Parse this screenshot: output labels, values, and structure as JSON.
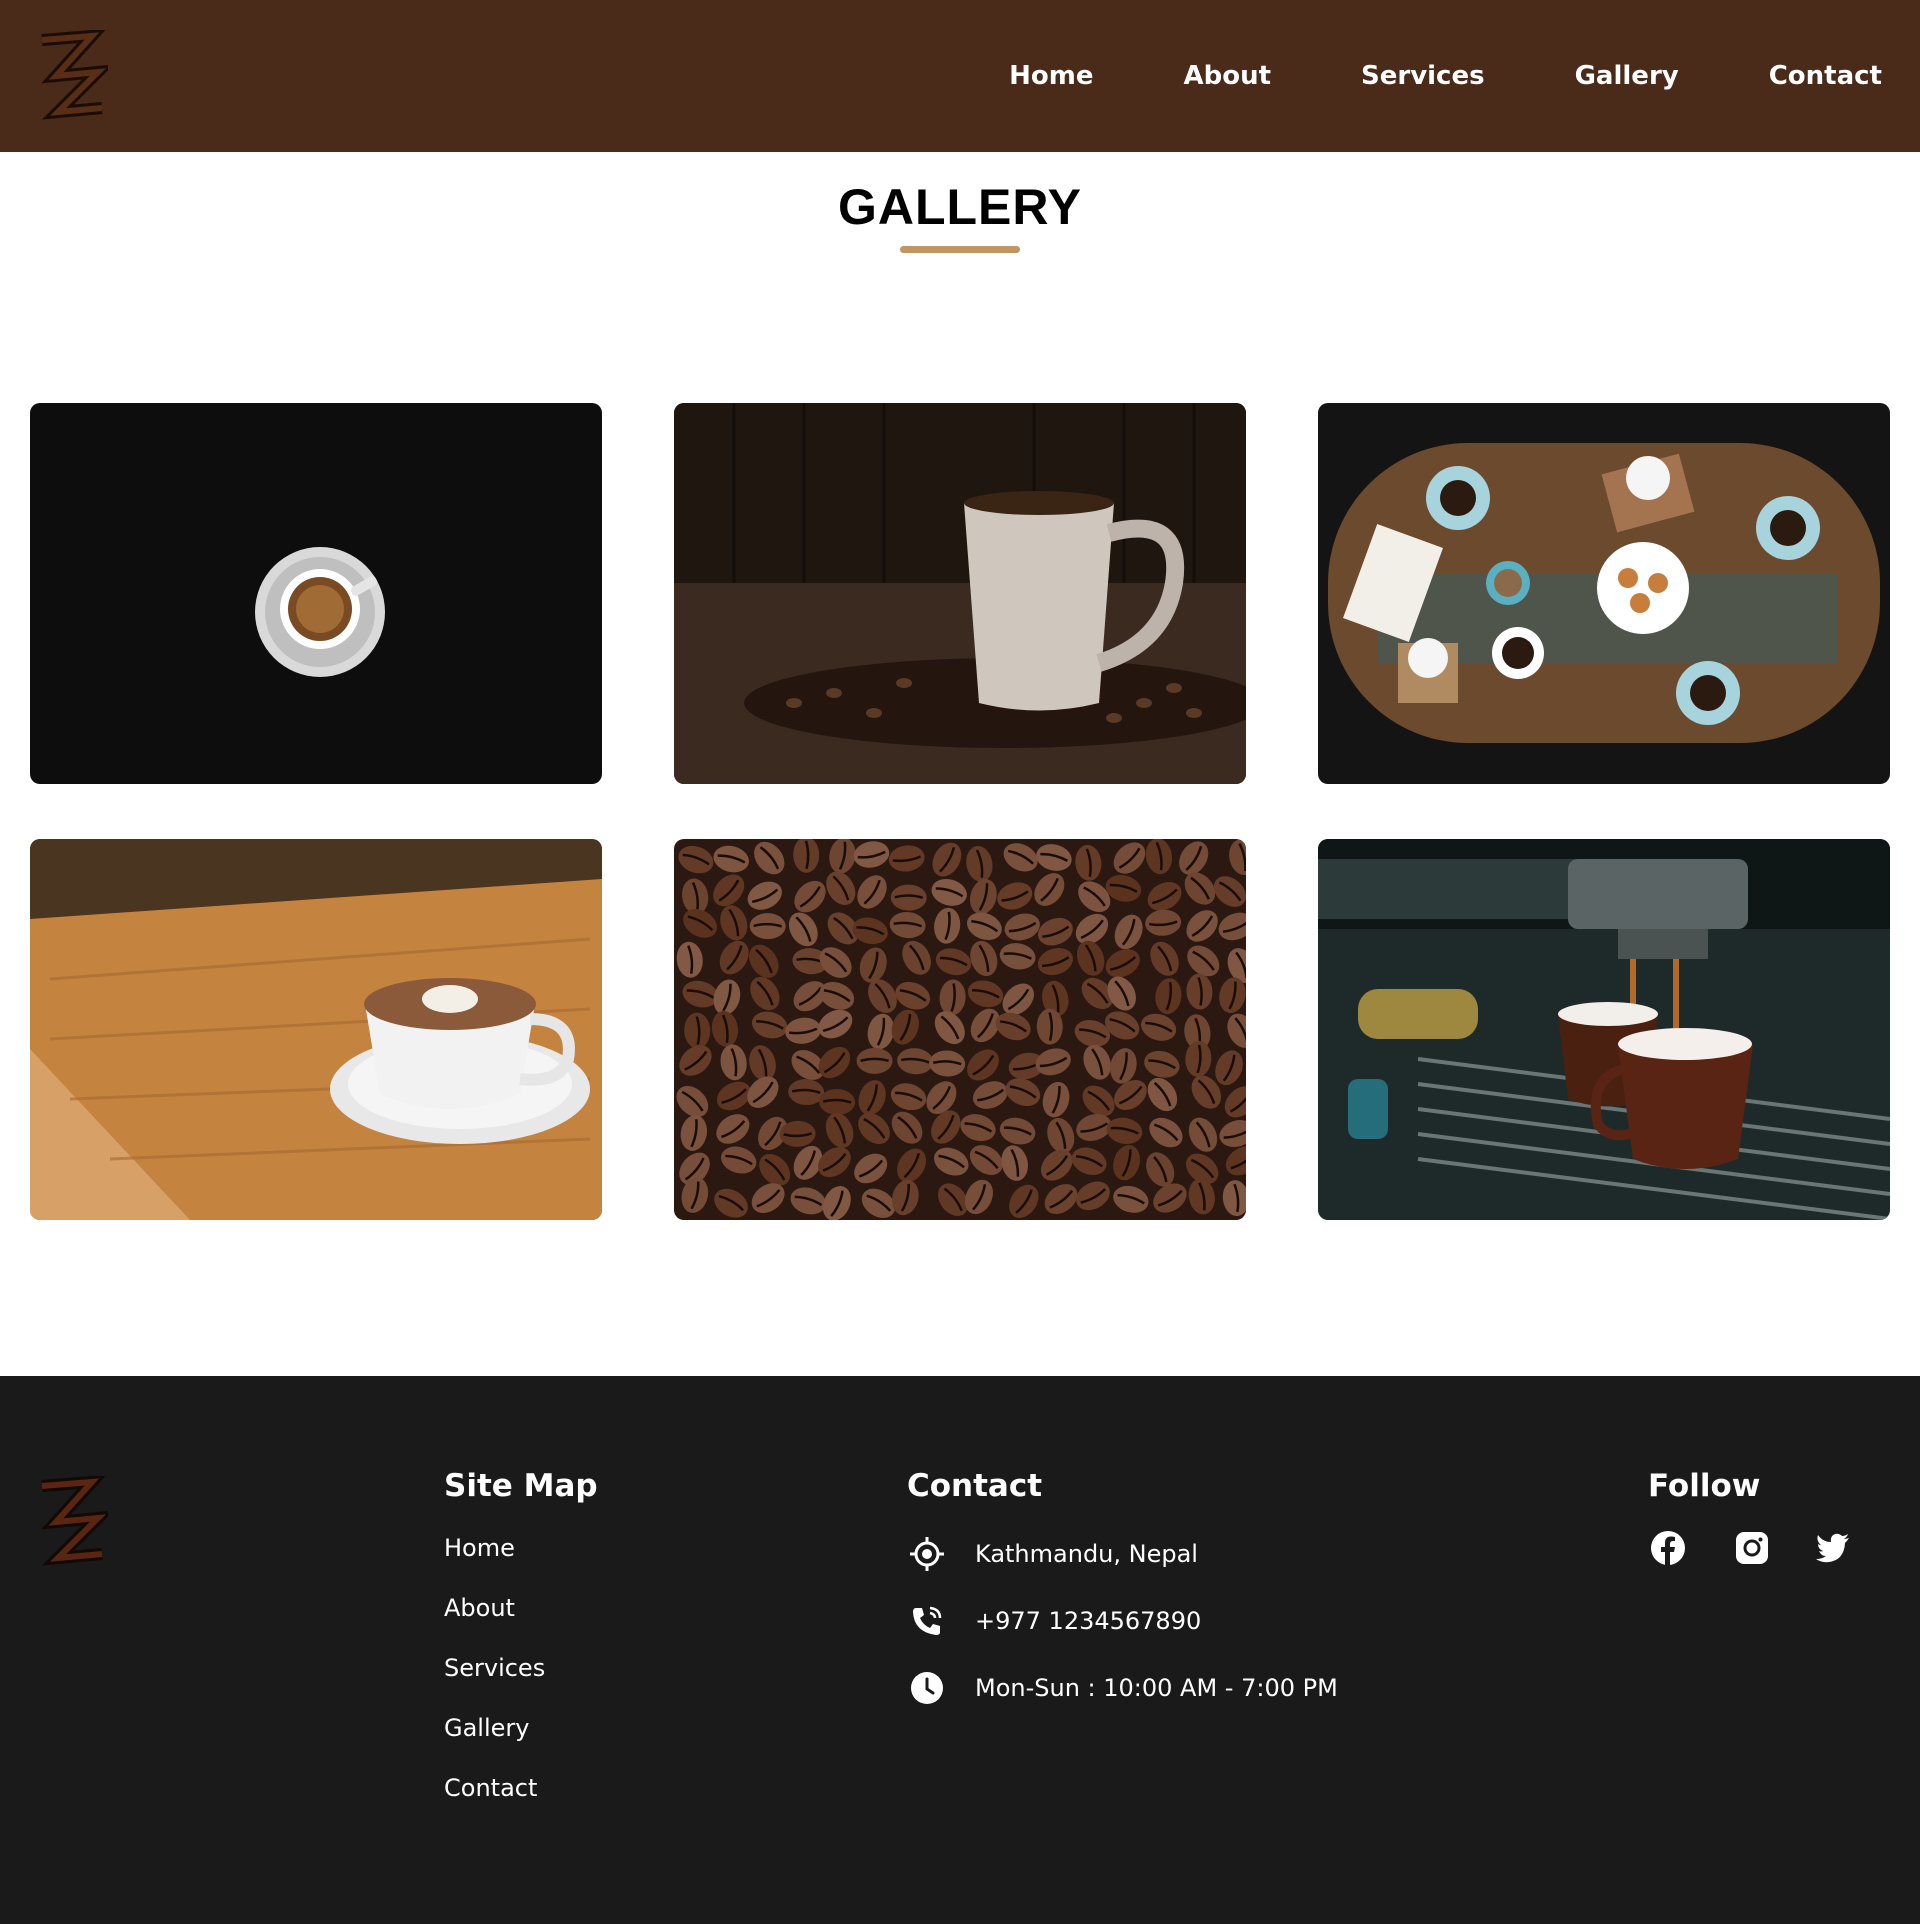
{
  "header": {
    "logo": "zz-logo",
    "nav": [
      "Home",
      "About",
      "Services",
      "Gallery",
      "Contact"
    ]
  },
  "page": {
    "title": "GALLERY",
    "accent_color": "#c1955f",
    "header_color": "#4a2a18",
    "footer_color": "#1a1a1a"
  },
  "gallery": {
    "images": [
      "espresso cup on dark table",
      "white mug with coffee beans",
      "cafe table with cups from above",
      "latte art cup on wooden table",
      "roasted coffee beans",
      "espresso machine pouring into cups"
    ]
  },
  "footer": {
    "sitemap_title": "Site Map",
    "sitemap_links": [
      "Home",
      "About",
      "Services",
      "Gallery",
      "Contact"
    ],
    "contact_title": "Contact",
    "contact": {
      "location": "Kathmandu, Nepal",
      "phone": "+977 1234567890",
      "hours": "Mon-Sun : 10:00 AM - 7:00 PM"
    },
    "follow_title": "Follow",
    "social_icons": [
      "facebook-icon",
      "instagram-icon",
      "twitter-icon"
    ]
  }
}
